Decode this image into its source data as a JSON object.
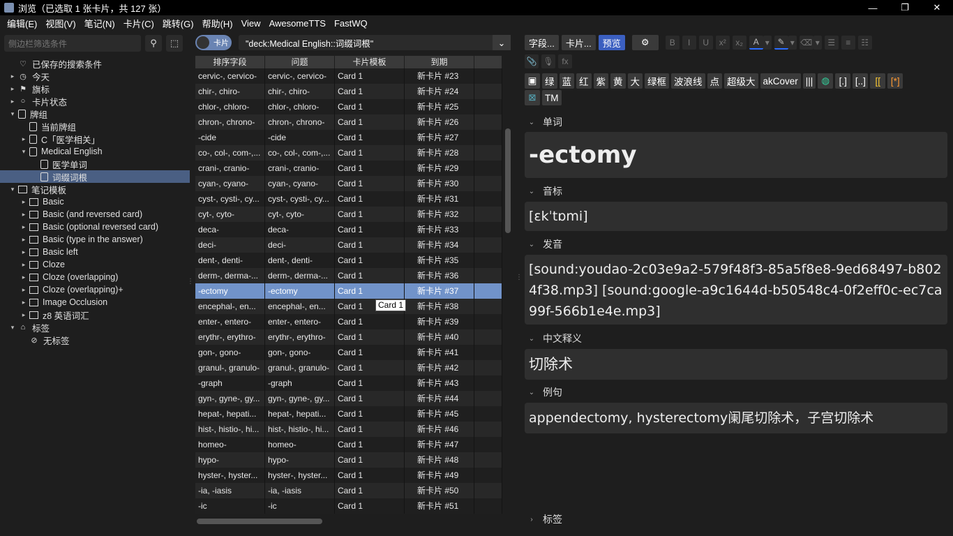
{
  "window": {
    "title": "浏览（已选取 1 张卡片，共 127 张）",
    "buttons": [
      "—",
      "❐",
      "✕"
    ]
  },
  "menu": [
    "编辑(E)",
    "视图(V)",
    "笔记(N)",
    "卡片(C)",
    "跳转(G)",
    "帮助(H)",
    "View",
    "AwesomeTTS",
    "FastWQ"
  ],
  "sidebar": {
    "search_placeholder": "侧边栏筛选条件",
    "items": [
      {
        "label": "已保存的搜索条件",
        "depth": 0,
        "arrow": "",
        "icon": "heart-icon",
        "glyph": "♡"
      },
      {
        "label": "今天",
        "depth": 0,
        "arrow": "▸",
        "icon": "clock-icon",
        "glyph": "◷"
      },
      {
        "label": "旗标",
        "depth": 0,
        "arrow": "▸",
        "icon": "flag-icon",
        "glyph": "⚑"
      },
      {
        "label": "卡片状态",
        "depth": 0,
        "arrow": "▸",
        "icon": "circle-icon",
        "glyph": "○"
      },
      {
        "label": "牌组",
        "depth": 0,
        "arrow": "▾",
        "icon": "deck-icon",
        "glyph": "box"
      },
      {
        "label": "当前牌组",
        "depth": 1,
        "arrow": "",
        "icon": "current-deck-icon",
        "glyph": "box"
      },
      {
        "label": "C「医学相关」",
        "depth": 1,
        "arrow": "▸",
        "icon": "deck-icon",
        "glyph": "box"
      },
      {
        "label": "Medical English",
        "depth": 1,
        "arrow": "▾",
        "icon": "deck-icon",
        "glyph": "box"
      },
      {
        "label": "医学单词",
        "depth": 2,
        "arrow": "",
        "icon": "deck-icon",
        "glyph": "box"
      },
      {
        "label": "词缀词根",
        "depth": 2,
        "arrow": "",
        "icon": "deck-icon",
        "glyph": "box",
        "selected": true
      },
      {
        "label": "笔记模板",
        "depth": 0,
        "arrow": "▾",
        "icon": "notetype-icon",
        "glyph": "grid"
      },
      {
        "label": "Basic",
        "depth": 1,
        "arrow": "▸",
        "icon": "notetype-icon",
        "glyph": "grid"
      },
      {
        "label": "Basic (and reversed card)",
        "depth": 1,
        "arrow": "▸",
        "icon": "notetype-icon",
        "glyph": "grid"
      },
      {
        "label": "Basic (optional reversed card)",
        "depth": 1,
        "arrow": "▸",
        "icon": "notetype-icon",
        "glyph": "grid"
      },
      {
        "label": "Basic (type in the answer)",
        "depth": 1,
        "arrow": "▸",
        "icon": "notetype-icon",
        "glyph": "grid"
      },
      {
        "label": "Basic left",
        "depth": 1,
        "arrow": "▸",
        "icon": "notetype-icon",
        "glyph": "grid"
      },
      {
        "label": "Cloze",
        "depth": 1,
        "arrow": "▸",
        "icon": "notetype-icon",
        "glyph": "grid"
      },
      {
        "label": "Cloze (overlapping)",
        "depth": 1,
        "arrow": "▸",
        "icon": "notetype-icon",
        "glyph": "grid"
      },
      {
        "label": "Cloze (overlapping)+",
        "depth": 1,
        "arrow": "▸",
        "icon": "notetype-icon",
        "glyph": "grid"
      },
      {
        "label": "Image Occlusion",
        "depth": 1,
        "arrow": "▸",
        "icon": "notetype-icon",
        "glyph": "grid"
      },
      {
        "label": "z8 英语词汇",
        "depth": 1,
        "arrow": "▸",
        "icon": "notetype-icon",
        "glyph": "grid"
      },
      {
        "label": "标签",
        "depth": 0,
        "arrow": "▾",
        "icon": "tag-icon",
        "glyph": "⌂"
      },
      {
        "label": "无标签",
        "depth": 1,
        "arrow": "",
        "icon": "no-tag-icon",
        "glyph": "⊘"
      }
    ]
  },
  "browser": {
    "toggle_label": "卡片",
    "query": "\"deck:Medical English::词缀词根\"",
    "columns": [
      "排序字段",
      "问题",
      "卡片模板",
      "到期",
      ""
    ],
    "tooltip": "Card 1",
    "rows": [
      [
        "cervic-, cervico-",
        "cervic-, cervico-",
        "Card 1",
        "新卡片 #23"
      ],
      [
        "chir-, chiro-",
        "chir-, chiro-",
        "Card 1",
        "新卡片 #24"
      ],
      [
        "chlor-, chloro-",
        "chlor-, chloro-",
        "Card 1",
        "新卡片 #25"
      ],
      [
        "chron-, chrono-",
        "chron-, chrono-",
        "Card 1",
        "新卡片 #26"
      ],
      [
        "-cide",
        "-cide",
        "Card 1",
        "新卡片 #27"
      ],
      [
        "co-, col-, com-,...",
        "co-, col-, com-,...",
        "Card 1",
        "新卡片 #28"
      ],
      [
        "crani-, cranio-",
        "crani-, cranio-",
        "Card 1",
        "新卡片 #29"
      ],
      [
        "cyan-, cyano-",
        "cyan-, cyano-",
        "Card 1",
        "新卡片 #30"
      ],
      [
        "cyst-, cysti-, cy...",
        "cyst-, cysti-, cy...",
        "Card 1",
        "新卡片 #31"
      ],
      [
        "cyt-, cyto-",
        "cyt-, cyto-",
        "Card 1",
        "新卡片 #32"
      ],
      [
        "deca-",
        "deca-",
        "Card 1",
        "新卡片 #33"
      ],
      [
        "deci-",
        "deci-",
        "Card 1",
        "新卡片 #34"
      ],
      [
        "dent-, denti-",
        "dent-, denti-",
        "Card 1",
        "新卡片 #35"
      ],
      [
        "derm-, derma-...",
        "derm-, derma-...",
        "Card 1",
        "新卡片 #36"
      ],
      [
        "-ectomy",
        "-ectomy",
        "Card 1",
        "新卡片 #37"
      ],
      [
        "encephal-, en...",
        "encephal-, en...",
        "Card 1",
        "新卡片 #38"
      ],
      [
        "enter-, entero-",
        "enter-, entero-",
        "Card 1",
        "新卡片 #39"
      ],
      [
        "erythr-, erythro-",
        "erythr-, erythro-",
        "Card 1",
        "新卡片 #40"
      ],
      [
        "gon-, gono-",
        "gon-, gono-",
        "Card 1",
        "新卡片 #41"
      ],
      [
        "granul-, granulo-",
        "granul-, granulo-",
        "Card 1",
        "新卡片 #42"
      ],
      [
        "-graph",
        "-graph",
        "Card 1",
        "新卡片 #43"
      ],
      [
        "gyn-, gyne-, gy...",
        "gyn-, gyne-, gy...",
        "Card 1",
        "新卡片 #44"
      ],
      [
        "hepat-, hepati...",
        "hepat-, hepati...",
        "Card 1",
        "新卡片 #45"
      ],
      [
        "hist-, histio-, hi...",
        "hist-, histio-, hi...",
        "Card 1",
        "新卡片 #46"
      ],
      [
        "homeo-",
        "homeo-",
        "Card 1",
        "新卡片 #47"
      ],
      [
        "hypo-",
        "hypo-",
        "Card 1",
        "新卡片 #48"
      ],
      [
        "hyster-, hyster...",
        "hyster-, hyster...",
        "Card 1",
        "新卡片 #49"
      ],
      [
        "-ia, -iasis",
        "-ia, -iasis",
        "Card 1",
        "新卡片 #50"
      ],
      [
        "-ic",
        "-ic",
        "Card 1",
        "新卡片 #51"
      ]
    ],
    "selected_row": 14
  },
  "editor": {
    "toolbar": {
      "fields_btn": "字段...",
      "cards_btn": "卡片...",
      "preview_btn": "预览"
    },
    "format_buttons": [
      "B",
      "I",
      "U",
      "x²",
      "x₂",
      "A",
      "▾",
      "✎",
      "▾",
      "⌫",
      "▾",
      "☰",
      "≡",
      "☷"
    ],
    "media_buttons": [
      "📎",
      "🎙",
      "fx"
    ],
    "addon_chips": [
      "绿",
      "蓝",
      "红",
      "紫",
      "黄",
      "大",
      "绿框",
      "波浪线",
      "点",
      "超级大",
      "akCover",
      "|||"
    ],
    "addon_chips2": [
      "TM"
    ],
    "fields": [
      {
        "label": "单词",
        "value": "-ectomy"
      },
      {
        "label": "音标",
        "value": "[ɛkˈtɒmi]"
      },
      {
        "label": "发音",
        "value": "[sound:youdao-2c03e9a2-579f48f3-85a5f8e8-9ed68497-b8024f38.mp3] [sound:google-a9c1644d-b50548c4-0f2eff0c-ec7ca99f-566b1e4e.mp3]"
      },
      {
        "label": "中文释义",
        "value": "切除术"
      },
      {
        "label": "例句",
        "value": "appendectomy, hysterectomy阑尾切除术，子宫切除术"
      }
    ],
    "tags_label": "标签"
  }
}
